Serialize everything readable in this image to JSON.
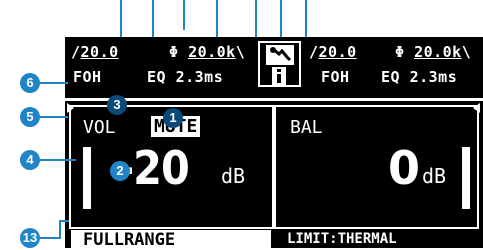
{
  "header_left": {
    "hpf": "20.0",
    "lpf": "20.0k",
    "fx": "FOH",
    "eq_label": "EQ",
    "delay": "2.3ms"
  },
  "header_right": {
    "hpf": "20.0",
    "lpf": "20.0k",
    "fx": "FOH",
    "eq_label": "EQ",
    "delay": "2.3ms"
  },
  "icons": {
    "phase": "phase-icon",
    "wrench": "wrench-icon",
    "info": "info-icon",
    "arrow_left": "arrow-left-icon",
    "arrow_right": "arrow-right-icon"
  },
  "left_panel": {
    "param_label": "VOL",
    "mute_label": "MUTE",
    "value": "-20",
    "unit": "dB"
  },
  "right_panel": {
    "param_label": "BAL",
    "value": "0",
    "unit": "dB"
  },
  "footer": {
    "mode": "FULLRANGE",
    "limit_status": "LIMIT:THERMAL"
  },
  "callouts": {
    "c1": "1",
    "c2": "2",
    "c3": "3",
    "c4": "4",
    "c5": "5",
    "c6": "6",
    "c13": "13"
  },
  "colors": {
    "lcd_bg": "#000000",
    "lcd_fg": "#ffffff",
    "callout_blue": "#1f84c8",
    "callout_dark": "#0b4a78"
  }
}
